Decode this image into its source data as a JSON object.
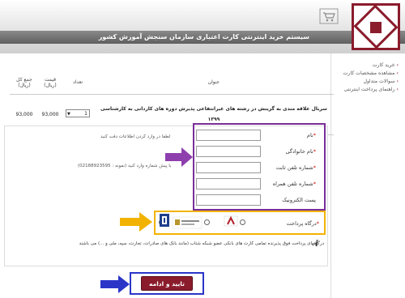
{
  "header": {
    "title": "سیستم خرید اینترنتی کارت اعتباری سازمان سنجش آموزش کشور"
  },
  "sidebar": {
    "items": [
      {
        "label": "خرید کارت"
      },
      {
        "label": "مشاهده مشخصات کارت"
      },
      {
        "label": "سوالات متداول"
      },
      {
        "label": "راهنمای پرداخت اینترنتی"
      }
    ]
  },
  "table": {
    "headers": {
      "title": "عنوان",
      "qty": "تعداد",
      "price": "قیمت (ریال)",
      "total": "جمع کل (ریال)"
    },
    "row": {
      "title": "سربال علاقه مندی به گزینش در رشته های غیرانتفاعی پذیرش دوره های کاردانی به کارشناسی ۱۳۹۹",
      "qty": "1",
      "price": "93,000",
      "total": "93,000"
    }
  },
  "form": {
    "fields": [
      {
        "label": "نام",
        "required": true
      },
      {
        "label": "نام خانوادگی",
        "required": true
      },
      {
        "label": "شماره تلفن ثابت",
        "required": true
      },
      {
        "label": "شماره تلفن همراه",
        "required": true
      },
      {
        "label": "پست الکترونیک",
        "required": false
      }
    ],
    "hint_name": "لطفا در وارد کردن اطلاعات دقت کنید",
    "hint_phone": "با پیش شماره وارد کنید (نمونه : 02188923595)",
    "gateway_label": "درگاه پرداخت",
    "notice": "درگاههای پرداخت فوق پذیرنده تمامی کارت های بانکی عضو شبکه شتاب (مانند بانک های صادرات، تجارت، سپه، ملی و ...) می باشند",
    "submit_label": "تایید و ادامه"
  },
  "colors": {
    "brand": "#8a1c2c",
    "purple_highlight": "#7a2e9a",
    "yellow_highlight": "#f2b300",
    "blue_highlight": "#2a35c8"
  },
  "icons": [
    "cart-icon",
    "logo-emblem",
    "info-icon",
    "arrow-icon"
  ]
}
